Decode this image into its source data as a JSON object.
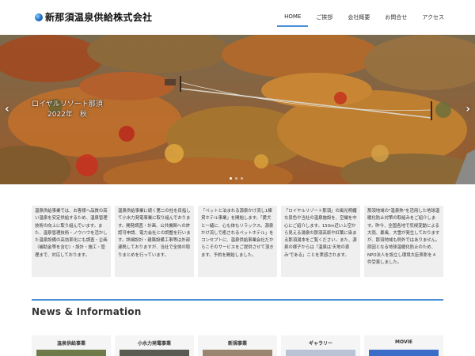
{
  "header": {
    "logo_text": "新那須温泉供給株式会社",
    "nav": [
      "HOME",
      "ご挨拶",
      "会社概要",
      "お問合せ",
      "アクセス"
    ],
    "active_index": 0
  },
  "slider": {
    "caption_line1": "ロイヤルリゾート那須",
    "caption_line2": "2022年　秋",
    "prev_glyph": "‹",
    "next_glyph": "›",
    "slide_count": 3,
    "current_slide": 1
  },
  "intro_boxes": [
    "温泉供給事業では、お客様へ品質の高い温泉を安定供給するため、温泉管理技術の向上に取り組んでいます。また、温泉管理技術・ノウハウを活かした温泉設備の高効率化にも調査・企画（補助金等を含む）・設計・施工・管理まで、対応しております。",
    "温泉供給事業に続く第二の柱を目指して小水力発電事業に取り組んでおります。開発調査・計画、公共機関への許認可申請、電力会社との調整を行います。詳細設計・建築設備工事等は外部連携しておりますが、当社で全体の取りまとめを行っています。",
    "「ペットと泊まれる源泉かけ流し1棟貸ホテル事業」を開始します。「愛犬と一緒に、心も体もリラックス。源泉かけ流しで癒されるペットホテル」をコンセプトに、温泉供給事業会社だからこそのサービスをご提供させて頂きます。予約を開始しました。",
    "「ロイヤルリゾート那須」の風光明媚な景色や当社の温泉施設を、空撮を中心にご紹介します。150m近い上空から見える湯泉の那須高原や紅葉に染まる那須湯本をご覧ください。また、源泉の様子からは「温泉は'天地の恵み'である」ことを実感されます。",
    "那須地域の\"温泉熱\"を活用した地球温暖化防止対策の取組みをご紹介します。昨今、全国各地で気候変動による大雨、暴風、大雪が発生しておりますが、那須地域も例外ではありません。原因となる地球温暖化防止のため、NPO法人を設立し環境大臣表彰を４件受賞しました。"
  ],
  "news": {
    "title": "News & Information",
    "categories": [
      "温泉供給事業",
      "小水力発電事業",
      "新規事業",
      "ギャラリー",
      "MOVIE"
    ]
  },
  "colors": {
    "accent": "#4a8fd8",
    "box_bg": "#efefef"
  }
}
